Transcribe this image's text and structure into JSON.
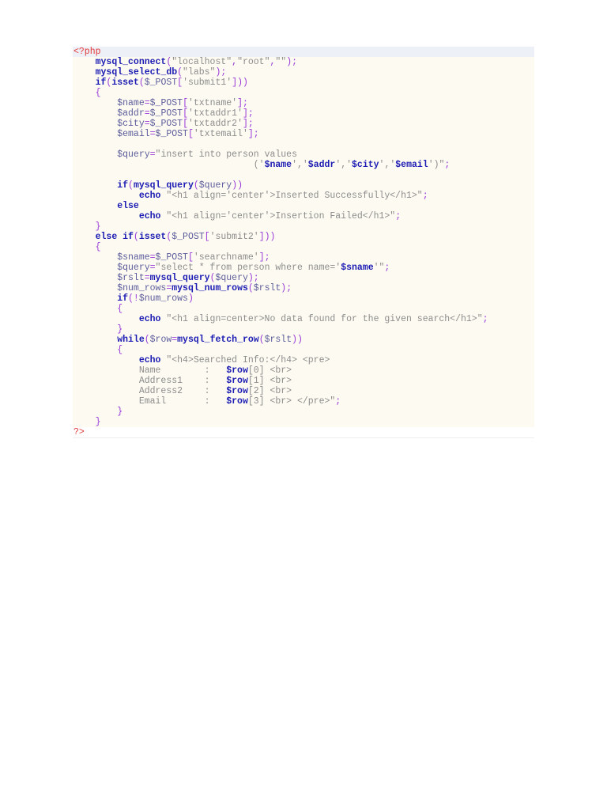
{
  "code_lines": [
    [
      [
        "tag",
        "<?php"
      ]
    ],
    [
      [
        "txt",
        "    "
      ],
      [
        "kw",
        "mysql_connect"
      ],
      [
        "punc",
        "("
      ],
      [
        "str",
        "\"localhost\""
      ],
      [
        "punc",
        ","
      ],
      [
        "str",
        "\"root\""
      ],
      [
        "punc",
        ","
      ],
      [
        "str",
        "\"\""
      ],
      [
        "punc",
        ");"
      ]
    ],
    [
      [
        "txt",
        "    "
      ],
      [
        "kw",
        "mysql_select_db"
      ],
      [
        "punc",
        "("
      ],
      [
        "str",
        "\"labs\""
      ],
      [
        "punc",
        ");"
      ]
    ],
    [
      [
        "txt",
        "    "
      ],
      [
        "kw",
        "if"
      ],
      [
        "punc",
        "("
      ],
      [
        "kw",
        "isset"
      ],
      [
        "punc",
        "("
      ],
      [
        "var",
        "$_POST"
      ],
      [
        "punc",
        "["
      ],
      [
        "str",
        "'submit1'"
      ],
      [
        "punc",
        "]))"
      ]
    ],
    [
      [
        "txt",
        "    "
      ],
      [
        "punc",
        "{"
      ]
    ],
    [
      [
        "txt",
        "        "
      ],
      [
        "var",
        "$name"
      ],
      [
        "punc",
        "="
      ],
      [
        "var",
        "$_POST"
      ],
      [
        "punc",
        "["
      ],
      [
        "str",
        "'txtname'"
      ],
      [
        "punc",
        "];"
      ]
    ],
    [
      [
        "txt",
        "        "
      ],
      [
        "var",
        "$addr"
      ],
      [
        "punc",
        "="
      ],
      [
        "var",
        "$_POST"
      ],
      [
        "punc",
        "["
      ],
      [
        "str",
        "'txtaddr1'"
      ],
      [
        "punc",
        "];"
      ]
    ],
    [
      [
        "txt",
        "        "
      ],
      [
        "var",
        "$city"
      ],
      [
        "punc",
        "="
      ],
      [
        "var",
        "$_POST"
      ],
      [
        "punc",
        "["
      ],
      [
        "str",
        "'txtaddr2'"
      ],
      [
        "punc",
        "];"
      ]
    ],
    [
      [
        "txt",
        "        "
      ],
      [
        "var",
        "$email"
      ],
      [
        "punc",
        "="
      ],
      [
        "var",
        "$_POST"
      ],
      [
        "punc",
        "["
      ],
      [
        "str",
        "'txtemail'"
      ],
      [
        "punc",
        "];"
      ]
    ],
    [
      [
        "txt",
        " "
      ]
    ],
    [
      [
        "txt",
        "        "
      ],
      [
        "var",
        "$query"
      ],
      [
        "punc",
        "="
      ],
      [
        "str",
        "\"insert into person values"
      ]
    ],
    [
      [
        "txt",
        "                                 "
      ],
      [
        "str",
        "('"
      ],
      [
        "kw",
        "$name"
      ],
      [
        "str",
        "','"
      ],
      [
        "kw",
        "$addr"
      ],
      [
        "str",
        "','"
      ],
      [
        "kw",
        "$city"
      ],
      [
        "str",
        "','"
      ],
      [
        "kw",
        "$email"
      ],
      [
        "str",
        "')\""
      ],
      [
        "punc",
        ";"
      ]
    ],
    [
      [
        "txt",
        " "
      ]
    ],
    [
      [
        "txt",
        "        "
      ],
      [
        "kw",
        "if"
      ],
      [
        "punc",
        "("
      ],
      [
        "kw",
        "mysql_query"
      ],
      [
        "punc",
        "("
      ],
      [
        "var",
        "$query"
      ],
      [
        "punc",
        "))"
      ]
    ],
    [
      [
        "txt",
        "            "
      ],
      [
        "kw",
        "echo"
      ],
      [
        "str",
        " \"<h1 align='center'>Inserted Successfully</h1>\""
      ],
      [
        "punc",
        ";"
      ]
    ],
    [
      [
        "txt",
        "        "
      ],
      [
        "kw",
        "else"
      ]
    ],
    [
      [
        "txt",
        "            "
      ],
      [
        "kw",
        "echo"
      ],
      [
        "str",
        " \"<h1 align='center'>Insertion Failed</h1>\""
      ],
      [
        "punc",
        ";"
      ]
    ],
    [
      [
        "txt",
        "    "
      ],
      [
        "punc",
        "}"
      ]
    ],
    [
      [
        "txt",
        "    "
      ],
      [
        "kw",
        "else if"
      ],
      [
        "punc",
        "("
      ],
      [
        "kw",
        "isset"
      ],
      [
        "punc",
        "("
      ],
      [
        "var",
        "$_POST"
      ],
      [
        "punc",
        "["
      ],
      [
        "str",
        "'submit2'"
      ],
      [
        "punc",
        "]))"
      ]
    ],
    [
      [
        "txt",
        "    "
      ],
      [
        "punc",
        "{"
      ]
    ],
    [
      [
        "txt",
        "        "
      ],
      [
        "var",
        "$sname"
      ],
      [
        "punc",
        "="
      ],
      [
        "var",
        "$_POST"
      ],
      [
        "punc",
        "["
      ],
      [
        "str",
        "'searchname'"
      ],
      [
        "punc",
        "];"
      ]
    ],
    [
      [
        "txt",
        "        "
      ],
      [
        "var",
        "$query"
      ],
      [
        "punc",
        "="
      ],
      [
        "str",
        "\"select * from person where name='"
      ],
      [
        "kw",
        "$sname"
      ],
      [
        "str",
        "'\""
      ],
      [
        "punc",
        ";"
      ]
    ],
    [
      [
        "txt",
        "        "
      ],
      [
        "var",
        "$rslt"
      ],
      [
        "punc",
        "="
      ],
      [
        "kw",
        "mysql_query"
      ],
      [
        "punc",
        "("
      ],
      [
        "var",
        "$query"
      ],
      [
        "punc",
        ");"
      ]
    ],
    [
      [
        "txt",
        "        "
      ],
      [
        "var",
        "$num_rows"
      ],
      [
        "punc",
        "="
      ],
      [
        "kw",
        "mysql_num_rows"
      ],
      [
        "punc",
        "("
      ],
      [
        "var",
        "$rslt"
      ],
      [
        "punc",
        ");"
      ]
    ],
    [
      [
        "txt",
        "        "
      ],
      [
        "kw",
        "if"
      ],
      [
        "punc",
        "(!"
      ],
      [
        "var",
        "$num_rows"
      ],
      [
        "punc",
        ")"
      ]
    ],
    [
      [
        "txt",
        "        "
      ],
      [
        "punc",
        "{"
      ]
    ],
    [
      [
        "txt",
        "            "
      ],
      [
        "kw",
        "echo"
      ],
      [
        "str",
        " \"<h1 align=center>No data found for the given search</h1>\""
      ],
      [
        "punc",
        ";"
      ]
    ],
    [
      [
        "txt",
        "        "
      ],
      [
        "punc",
        "}"
      ]
    ],
    [
      [
        "txt",
        "        "
      ],
      [
        "kw",
        "while"
      ],
      [
        "punc",
        "("
      ],
      [
        "var",
        "$row"
      ],
      [
        "punc",
        "="
      ],
      [
        "kw",
        "mysql_fetch_row"
      ],
      [
        "punc",
        "("
      ],
      [
        "var",
        "$rslt"
      ],
      [
        "punc",
        "))"
      ]
    ],
    [
      [
        "txt",
        "        "
      ],
      [
        "punc",
        "{"
      ]
    ],
    [
      [
        "txt",
        "            "
      ],
      [
        "kw",
        "echo"
      ],
      [
        "str",
        " \"<h4>Searched Info:</h4> <pre>"
      ]
    ],
    [
      [
        "txt",
        "            "
      ],
      [
        "str",
        "Name        :   "
      ],
      [
        "kw",
        "$row"
      ],
      [
        "str",
        "[0] <br>"
      ]
    ],
    [
      [
        "txt",
        "            "
      ],
      [
        "str",
        "Address1    :   "
      ],
      [
        "kw",
        "$row"
      ],
      [
        "str",
        "[1] <br>"
      ]
    ],
    [
      [
        "txt",
        "            "
      ],
      [
        "str",
        "Address2    :   "
      ],
      [
        "kw",
        "$row"
      ],
      [
        "str",
        "[2] <br>"
      ]
    ],
    [
      [
        "txt",
        "            "
      ],
      [
        "str",
        "Email       :   "
      ],
      [
        "kw",
        "$row"
      ],
      [
        "str",
        "[3] <br> </pre>\""
      ],
      [
        "punc",
        ";"
      ]
    ],
    [
      [
        "txt",
        "        "
      ],
      [
        "punc",
        "}"
      ]
    ],
    [
      [
        "txt",
        "    "
      ],
      [
        "punc",
        "}"
      ]
    ],
    [
      [
        "tag",
        "?>"
      ]
    ]
  ]
}
